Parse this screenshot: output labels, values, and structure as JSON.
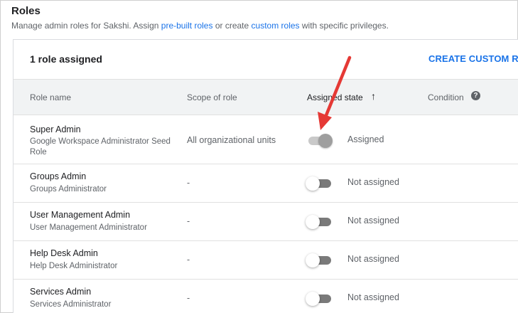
{
  "header": {
    "title": "Roles",
    "subtitle_pre": "Manage admin roles for Sakshi. Assign ",
    "link_prebuilt": "pre-built roles",
    "subtitle_mid": " or create ",
    "link_custom": "custom roles",
    "subtitle_post": " with specific privileges."
  },
  "card": {
    "count_label": "1 role assigned",
    "create_button": "CREATE CUSTOM RO"
  },
  "columns": {
    "role_name": "Role name",
    "scope": "Scope of role",
    "assigned_state": "Assigned state",
    "sort_icon": "↑",
    "condition": "Condition",
    "help_icon": "?"
  },
  "rows": [
    {
      "name": "Super Admin",
      "sub": "Google Workspace Administrator Seed Role",
      "scope": "All organizational units",
      "state": "Assigned",
      "on": true
    },
    {
      "name": "Groups Admin",
      "sub": "Groups Administrator",
      "scope": "-",
      "state": "Not assigned",
      "on": false
    },
    {
      "name": "User Management Admin",
      "sub": "User Management Administrator",
      "scope": "-",
      "state": "Not assigned",
      "on": false
    },
    {
      "name": "Help Desk Admin",
      "sub": "Help Desk Administrator",
      "scope": "-",
      "state": "Not assigned",
      "on": false
    },
    {
      "name": "Services Admin",
      "sub": "Services Administrator",
      "scope": "-",
      "state": "Not assigned",
      "on": false
    }
  ],
  "annotation": {
    "arrow_color": "#e53935"
  }
}
